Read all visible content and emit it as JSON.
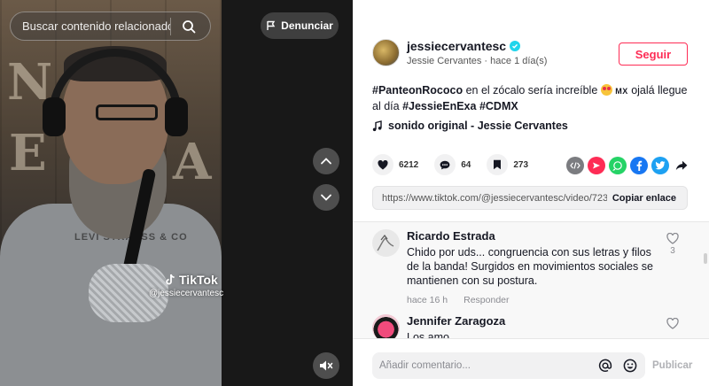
{
  "video": {
    "search_placeholder": "Buscar contenido relacionado",
    "report_label": "Denunciar",
    "watermark_brand": "TikTok",
    "watermark_handle": "@jessiecervantesc",
    "shirt_print": "LEVI STRAUSS & CO"
  },
  "author": {
    "handle": "jessiecervantesc",
    "display_name": "Jessie Cervantes",
    "separator": " · ",
    "posted": "hace 1 día(s)",
    "follow_label": "Seguir"
  },
  "description": {
    "tag1": "#PanteonRococo",
    "text1": " en el zócalo sería increíble ",
    "flag": "MX",
    "text2": " ojalá llegue al día ",
    "tag2": "#JessieEnExa",
    "tag3": "#CDMX"
  },
  "music": {
    "label": "sonido original - Jessie Cervantes"
  },
  "stats": {
    "likes": "6212",
    "comments": "64",
    "saves": "273"
  },
  "share": {
    "link": "https://www.tiktok.com/@jessiecervantesc/video/7239...",
    "copy_label": "Copiar enlace"
  },
  "comments": [
    {
      "name": "Ricardo Estrada",
      "text": "Chido por uds... congruencia con sus letras y filos de la banda! Surgidos en movimientos sociales se mantienen con su postura.",
      "time": "hace 16 h",
      "reply": "Responder",
      "likes": "3"
    },
    {
      "name": "Jennifer Zaragoza",
      "text": "Los amo"
    }
  ],
  "composer": {
    "placeholder": "Añadir comentario...",
    "post_label": "Publicar"
  },
  "colors": {
    "accent": "#fe2c55",
    "verified": "#20d5ec"
  }
}
